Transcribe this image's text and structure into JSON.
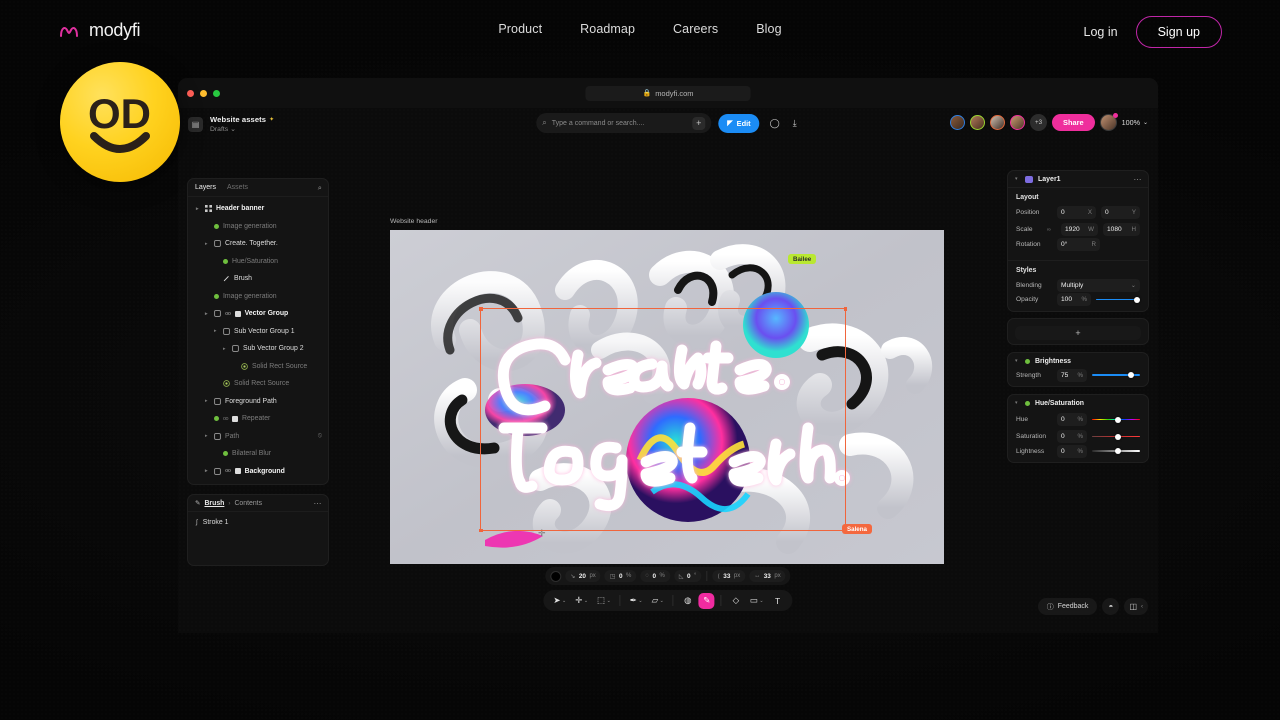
{
  "site_nav": {
    "brand": "modyfi",
    "brand_icon": "modyfi-logo-icon",
    "links": [
      "Product",
      "Roadmap",
      "Careers",
      "Blog"
    ],
    "login_label": "Log in",
    "signup_label": "Sign up",
    "signup_border_color": "#c026a8"
  },
  "badge": {
    "name": "smiley-face-badge",
    "eyes_text": "OD",
    "color": "#ffd21f"
  },
  "browser": {
    "url": "modyfi.com",
    "lock_icon": "lock-icon",
    "traffic_lights": [
      "#ff5f57",
      "#febc2e",
      "#28c840"
    ]
  },
  "app_bar": {
    "doc_icon": "document-icon",
    "doc_title": "Website assets",
    "doc_title_sparkle": "✦",
    "doc_subtitle": "Drafts",
    "search": {
      "icon": "search-icon",
      "placeholder": "Type a command or search....",
      "plus_label": "+"
    },
    "edit_button": {
      "label": "Edit",
      "icon": "cursor-icon",
      "color": "#1b8cf5"
    },
    "comment_icon": "comment-icon",
    "download_icon": "download-icon",
    "collaborators_overflow": "+3",
    "share_button": {
      "label": "Share",
      "color": "#ef2e9c"
    },
    "zoom_level": "100%",
    "zoom_caret": "chevron-down-icon"
  },
  "layers_panel": {
    "tabs": [
      {
        "label": "Layers",
        "active": true
      },
      {
        "label": "Assets",
        "active": false
      }
    ],
    "search_icon": "search-icon",
    "items": [
      {
        "label": "Header banner",
        "indent": 0,
        "style": "bold",
        "icon": "grid-icon",
        "caret": true
      },
      {
        "label": "Image generation",
        "indent": 1,
        "style": "dim",
        "icon": "effect-icon",
        "caret": false
      },
      {
        "label": "Create. Together.",
        "indent": 1,
        "style": "normal",
        "icon": "group-icon",
        "caret": true
      },
      {
        "label": "Hue/Saturation",
        "indent": 2,
        "style": "dim",
        "icon": "effect-icon",
        "caret": false
      },
      {
        "label": "Brush",
        "indent": 2,
        "style": "normal",
        "icon": "brush-icon",
        "caret": false
      },
      {
        "label": "Image generation",
        "indent": 1,
        "style": "dim",
        "icon": "effect-icon",
        "caret": false
      },
      {
        "label": "Vector Group",
        "indent": 1,
        "style": "bold",
        "icon": "group-icon",
        "caret": true,
        "oo": true,
        "mask": true
      },
      {
        "label": "Sub Vector Group 1",
        "indent": 2,
        "style": "normal",
        "icon": "group-icon",
        "caret": true
      },
      {
        "label": "Sub Vector Group 2",
        "indent": 3,
        "style": "normal",
        "icon": "group-icon",
        "caret": true
      },
      {
        "label": "Solid Rect Source",
        "indent": 4,
        "style": "dim",
        "icon": "source-icon",
        "caret": false
      },
      {
        "label": "Solid Rect Source",
        "indent": 2,
        "style": "dim",
        "icon": "source-icon",
        "caret": false
      },
      {
        "label": "Foreground Path",
        "indent": 1,
        "style": "normal",
        "icon": "group-icon",
        "caret": true
      },
      {
        "label": "Repeater",
        "indent": 1,
        "style": "dim",
        "icon": "effect-icon",
        "caret": false,
        "oo": true,
        "mask": true
      },
      {
        "label": "Path",
        "indent": 1,
        "style": "dim",
        "icon": "group-icon",
        "caret": true,
        "hidden": true
      },
      {
        "label": "Bilateral Blur",
        "indent": 2,
        "style": "dim",
        "icon": "effect-icon",
        "caret": false
      },
      {
        "label": "Background",
        "indent": 1,
        "style": "bold",
        "icon": "group-icon",
        "caret": true,
        "oo": true,
        "mask": true
      }
    ]
  },
  "brush_panel": {
    "title": "Brush",
    "separator": "›",
    "crumb": "Contents",
    "menu_icon": "more-options-icon",
    "rows": [
      {
        "label": "Stroke 1",
        "icon": "stroke-icon"
      }
    ]
  },
  "properties_panel": {
    "layer_name": "Layer1",
    "menu_icon": "more-options-icon",
    "layout": {
      "title": "Layout",
      "rows": [
        {
          "label": "Position",
          "fields": [
            {
              "value": "0",
              "unit": "X"
            },
            {
              "value": "0",
              "unit": "Y"
            }
          ]
        },
        {
          "label": "Scale",
          "link_icon": "link-icon",
          "fields": [
            {
              "value": "1920",
              "unit": "W"
            },
            {
              "value": "1080",
              "unit": "H"
            }
          ]
        },
        {
          "label": "Rotation",
          "fields": [
            {
              "value": "0°",
              "unit": "R"
            }
          ]
        }
      ]
    },
    "styles": {
      "title": "Styles",
      "blending_label": "Blending",
      "blending_value": "Multiply",
      "opacity_label": "Opacity",
      "opacity_value": "100",
      "opacity_unit": "%",
      "opacity_pct": 100
    },
    "add_button": "+",
    "effects": [
      {
        "name": "Brightness",
        "rows": [
          {
            "label": "Strength",
            "value": "75",
            "unit": "%",
            "pct": 75,
            "track": "blue"
          }
        ]
      },
      {
        "name": "Hue/Saturation",
        "rows": [
          {
            "label": "Hue",
            "value": "0",
            "unit": "%",
            "pct": 50,
            "track": "hue"
          },
          {
            "label": "Saturation",
            "value": "0",
            "unit": "%",
            "pct": 50,
            "track": "sat"
          },
          {
            "label": "Lightness",
            "value": "0",
            "unit": "%",
            "pct": 50,
            "track": "light"
          }
        ]
      }
    ]
  },
  "canvas": {
    "artboard_label": "Website header",
    "headline_line1": "Create.",
    "headline_line2": "Together.",
    "selection_color": "#f0653c",
    "cursors": [
      {
        "name": "Bailee",
        "color": "#b9e831"
      },
      {
        "name": "Salena",
        "color": "#f4683e"
      }
    ]
  },
  "property_bar": {
    "swatch_color": "#000000",
    "chips": [
      {
        "icon": "stroke-width-icon",
        "value": "20",
        "unit": "px"
      },
      {
        "icon": "flow-icon",
        "value": "0",
        "unit": "%"
      },
      {
        "icon": "hardness-icon",
        "value": "0",
        "unit": "%"
      },
      {
        "icon": "angle-icon",
        "value": "0",
        "unit": "°"
      },
      {
        "icon": "spacing-icon",
        "value": "33",
        "unit": "px"
      },
      {
        "icon": "offset-icon",
        "value": "33",
        "unit": "px"
      }
    ]
  },
  "toolbar": {
    "tools": [
      {
        "name": "select-tool",
        "glyph": "➤",
        "caret": true,
        "active": false
      },
      {
        "name": "move-tool",
        "glyph": "✛",
        "caret": true,
        "active": false
      },
      {
        "name": "frame-tool",
        "glyph": "⬚",
        "caret": true,
        "active": false
      },
      {
        "name": "pen-tool",
        "glyph": "✒",
        "caret": true,
        "active": false
      },
      {
        "name": "shape-tool",
        "glyph": "▱",
        "caret": true,
        "active": false
      },
      {
        "name": "stamp-tool",
        "glyph": "◍",
        "caret": false,
        "active": false
      },
      {
        "name": "brush-tool",
        "glyph": "✎",
        "caret": false,
        "active": true
      },
      {
        "name": "eraser-tool",
        "glyph": "◇",
        "caret": false,
        "active": false
      },
      {
        "name": "crop-tool",
        "glyph": "▭",
        "caret": true,
        "active": false
      },
      {
        "name": "text-tool",
        "glyph": "T",
        "caret": false,
        "active": false
      }
    ],
    "active_color": "#f02ba0"
  },
  "bottom_right": {
    "feedback_label": "Feedback",
    "feedback_icon": "info-icon",
    "notifications_icon": "bell-icon",
    "panel_toggle_icon": "panel-icon",
    "collapse_icon": "chevron-left-icon"
  }
}
